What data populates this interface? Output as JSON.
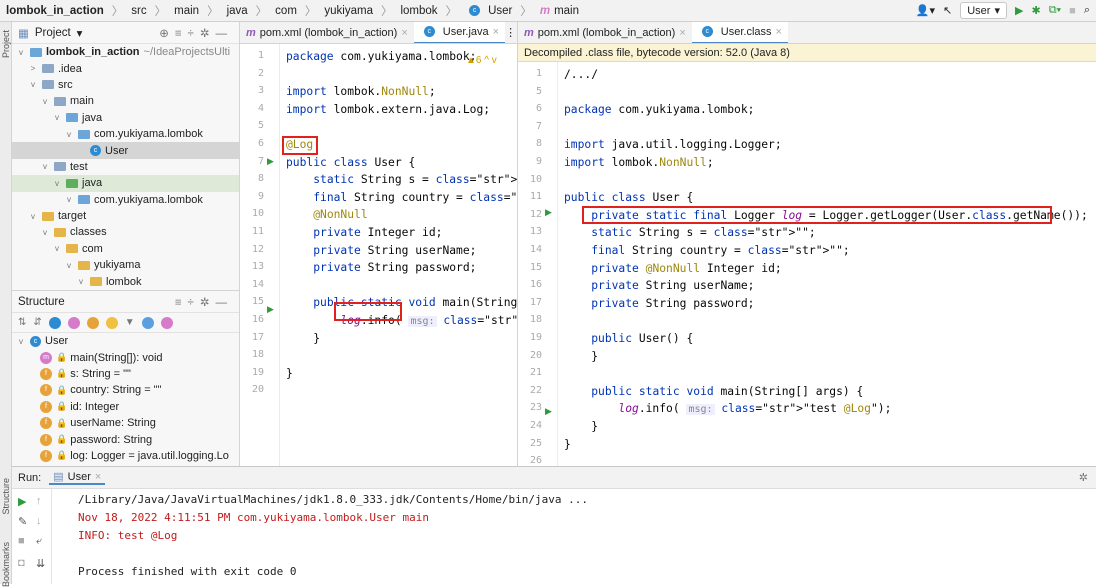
{
  "breadcrumb": [
    "lombok_in_action",
    "src",
    "main",
    "java",
    "com",
    "yukiyama",
    "lombok",
    "User",
    "main"
  ],
  "run_config": "User",
  "left_strip": {
    "top": "Project",
    "mid": "Structure",
    "bottom": "Bookmarks"
  },
  "project": {
    "title": "Project",
    "tree": [
      {
        "label": "lombok_in_action",
        "suffix": "~/IdeaProjectsUlti",
        "indent": 0,
        "type": "root",
        "exp": "v"
      },
      {
        "label": ".idea",
        "indent": 1,
        "type": "folder",
        "exp": ">"
      },
      {
        "label": "src",
        "indent": 1,
        "type": "folder",
        "exp": "v"
      },
      {
        "label": "main",
        "indent": 2,
        "type": "folder",
        "exp": "v"
      },
      {
        "label": "java",
        "indent": 3,
        "type": "src",
        "exp": "v"
      },
      {
        "label": "com.yukiyama.lombok",
        "indent": 4,
        "type": "pkg",
        "exp": "v"
      },
      {
        "label": "User",
        "indent": 5,
        "type": "class",
        "exp": "",
        "sel": "grey"
      },
      {
        "label": "test",
        "indent": 2,
        "type": "folder",
        "exp": "v"
      },
      {
        "label": "java",
        "indent": 3,
        "type": "test",
        "exp": "v",
        "sel": "green"
      },
      {
        "label": "com.yukiyama.lombok",
        "indent": 4,
        "type": "pkg",
        "exp": "v"
      },
      {
        "label": "target",
        "indent": 1,
        "type": "yfolder",
        "exp": "v"
      },
      {
        "label": "classes",
        "indent": 2,
        "type": "yfolder",
        "exp": "v"
      },
      {
        "label": "com",
        "indent": 3,
        "type": "yfolder",
        "exp": "v"
      },
      {
        "label": "yukiyama",
        "indent": 4,
        "type": "yfolder",
        "exp": "v"
      },
      {
        "label": "lombok",
        "indent": 5,
        "type": "yfolder",
        "exp": "v"
      },
      {
        "label": "User",
        "indent": 6,
        "type": "class",
        "exp": ""
      }
    ]
  },
  "structure": {
    "title": "Structure",
    "root": "User",
    "members": [
      {
        "icon": "m",
        "label": "main(String[]): void"
      },
      {
        "icon": "f",
        "label": "s: String = \"\""
      },
      {
        "icon": "f",
        "label": "country: String = \"\""
      },
      {
        "icon": "f",
        "label": "id: Integer"
      },
      {
        "icon": "f",
        "label": "userName: String"
      },
      {
        "icon": "f",
        "label": "password: String"
      },
      {
        "icon": "f",
        "label": "log: Logger = java.util.logging.Lo"
      }
    ]
  },
  "editor1": {
    "tabs": [
      "pom.xml (lombok_in_action)",
      "User.java"
    ],
    "warning": "▲6",
    "line_numbers": [
      "1",
      "2",
      "3",
      "4",
      "5",
      "6",
      "7",
      "8",
      "9",
      "10",
      "11",
      "12",
      "13",
      "14",
      "15",
      "16",
      "17",
      "18",
      "19",
      "20"
    ],
    "lines": [
      "package com.yukiyama.lombok;",
      "",
      "import lombok.NonNull;",
      "import lombok.extern.java.Log;",
      "",
      "@Log",
      "public class User {",
      "    static String s = \"\";",
      "    final String country = \"\";",
      "    @NonNull",
      "    private Integer id;",
      "    private String userName;",
      "    private String password;",
      "",
      "    public static void main(String[] a",
      "        log.info( msg: \"test @Log\");",
      "    }",
      "",
      "}",
      ""
    ]
  },
  "editor2": {
    "tabs": [
      "pom.xml (lombok_in_action)",
      "User.class"
    ],
    "banner": "Decompiled .class file, bytecode version: 52.0 (Java 8)",
    "line_numbers": [
      "1",
      "5",
      "6",
      "7",
      "8",
      "9",
      "10",
      "11",
      "12",
      "13",
      "14",
      "15",
      "16",
      "17",
      "18",
      "19",
      "20",
      "21",
      "22",
      "23",
      "24",
      "25",
      "26"
    ],
    "lines": [
      "/.../",
      "",
      "package com.yukiyama.lombok;",
      "",
      "import java.util.logging.Logger;",
      "import lombok.NonNull;",
      "",
      "public class User {",
      "    private static final Logger log = Logger.getLogger(User.class.getName());",
      "    static String s = \"\";",
      "    final String country = \"\";",
      "    private @NonNull Integer id;",
      "    private String userName;",
      "    private String password;",
      "",
      "    public User() {",
      "    }",
      "",
      "    public static void main(String[] args) {",
      "        log.info( msg: \"test @Log\");",
      "    }",
      "}",
      ""
    ]
  },
  "run": {
    "label": "Run:",
    "tab": "User",
    "output": [
      "/Library/Java/JavaVirtualMachines/jdk1.8.0_333.jdk/Contents/Home/bin/java ...",
      "Nov 18, 2022 4:11:51 PM com.yukiyama.lombok.User main",
      "INFO: test @Log",
      "",
      "Process finished with exit code 0"
    ]
  }
}
